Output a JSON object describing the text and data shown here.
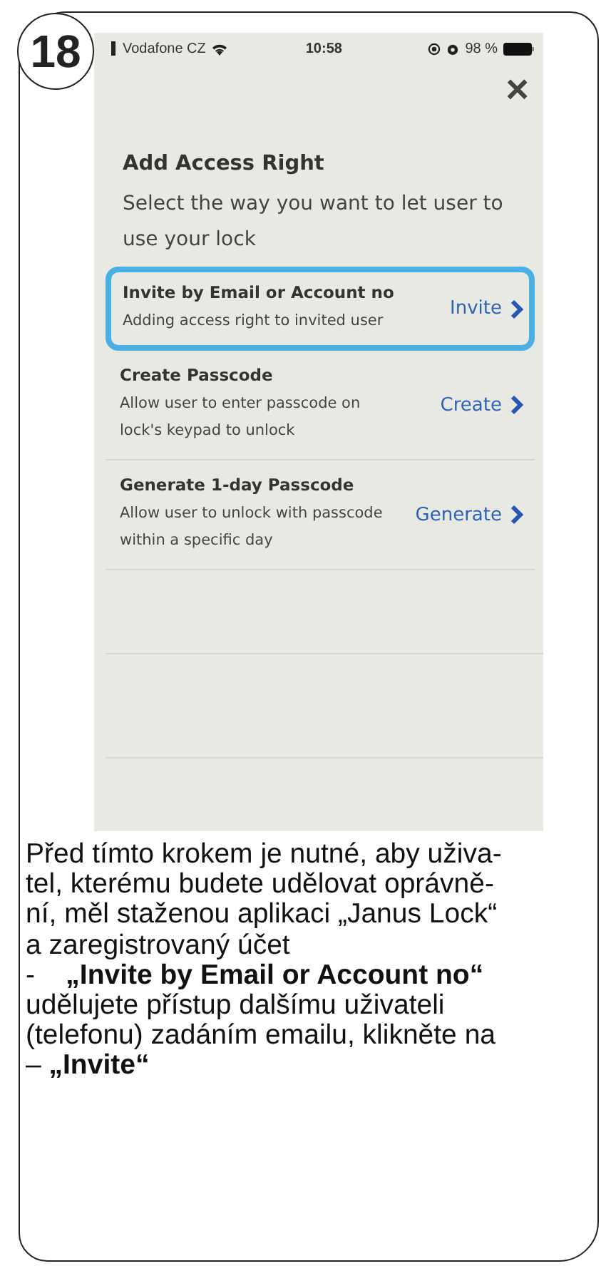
{
  "step": "18",
  "status_bar": {
    "carrier": "Vodafone CZ",
    "time": "10:58",
    "battery": "98 %"
  },
  "close": "×",
  "title": "Add Access Right",
  "subtitle": "Select the way you want to let user to use your lock",
  "options": [
    {
      "title": "Invite by Email or Account no",
      "description": "Adding access right to invited user",
      "action": "Invite",
      "selected": true
    },
    {
      "title": "Create Passcode",
      "description": "Allow user to enter passcode on lock's keypad to unlock",
      "action": "Create",
      "selected": false
    },
    {
      "title": "Generate 1-day Passcode",
      "description": "Allow user to unlock with passcode within a specific day",
      "action": "Generate",
      "selected": false
    }
  ],
  "instructions": "Před tímto krokem je nutné, aby uživa-\ntel, kterému budete udělovat oprávně-\nní, měl staženou aplikaci „Janus Lock“\na zaregistrovaný účet\n-    **„Invite by Email or Account no“**\nudělujete přístup dalšímu uživateli\n(telefonu) zadáním emailu, klikněte na\n– **„Invite“**"
}
